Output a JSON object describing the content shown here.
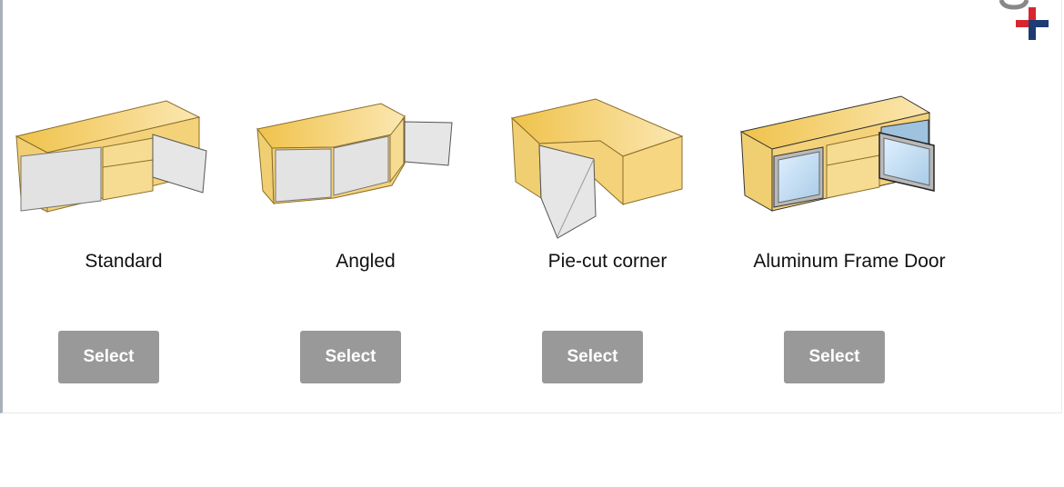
{
  "products": [
    {
      "label": "Standard",
      "button": "Select"
    },
    {
      "label": "Angled",
      "button": "Select"
    },
    {
      "label": "Pie-cut corner",
      "button": "Select"
    },
    {
      "label": "Aluminum Frame Door",
      "button": "Select"
    }
  ],
  "colors": {
    "button_bg": "#999999",
    "cabinet_wood": "#f2c95a",
    "door": "#e3e3e3",
    "logo_red": "#d7262e",
    "logo_blue": "#1f3b73"
  }
}
